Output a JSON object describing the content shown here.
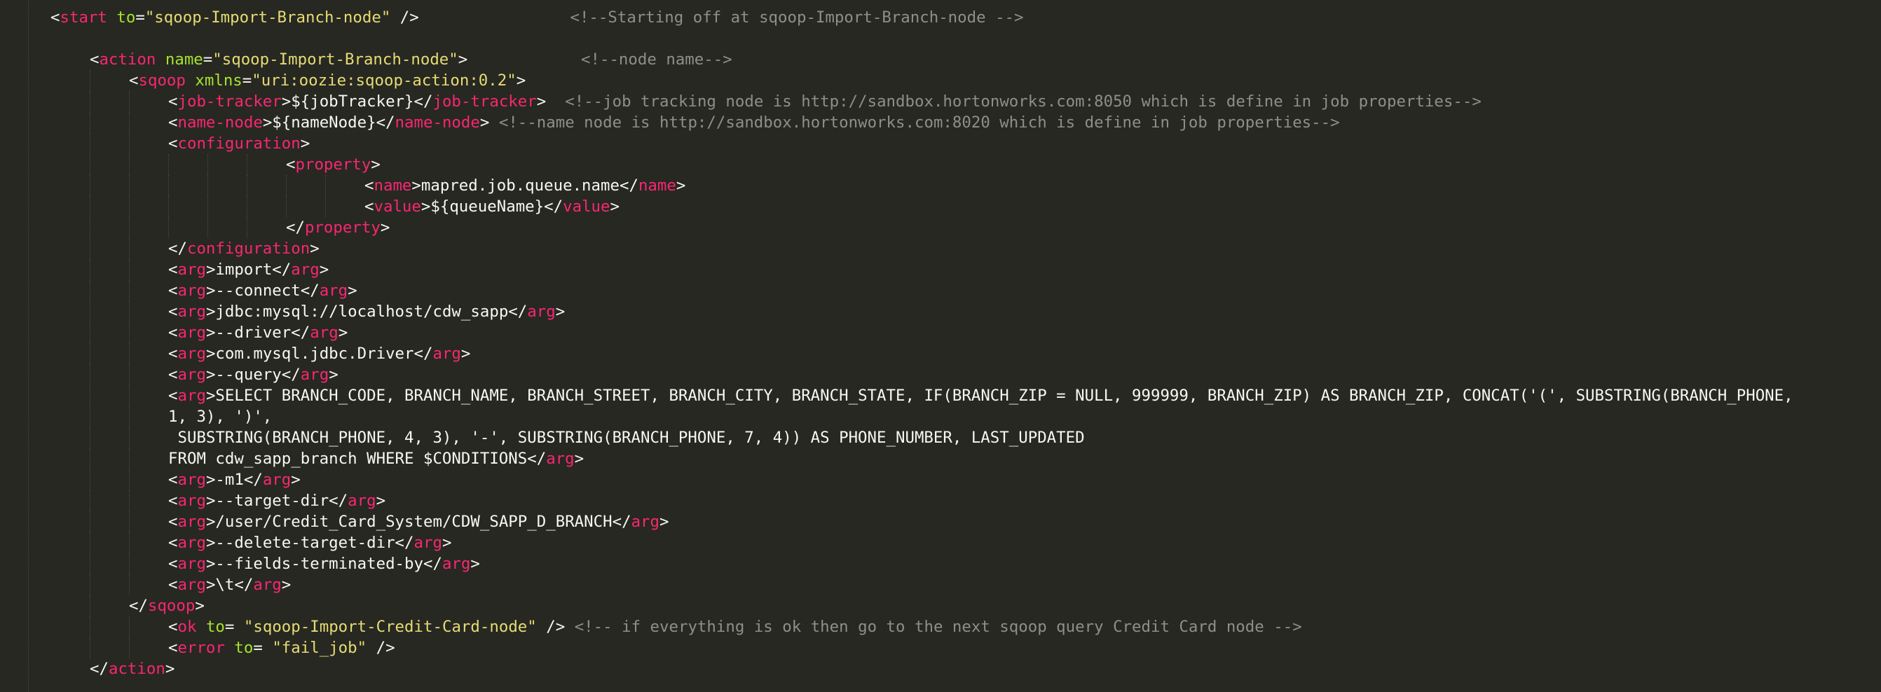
{
  "theme": {
    "background": "#272822",
    "plain": "#f8f8f2",
    "tag": "#f92672",
    "attribute": "#a6e22e",
    "string": "#e6db74",
    "comment": "#8f8f88"
  },
  "lines": [
    {
      "segs": [
        [
          "p",
          "<"
        ],
        [
          "t",
          "start"
        ],
        [
          "p",
          " "
        ],
        [
          "a",
          "to"
        ],
        [
          "p",
          "="
        ],
        [
          "s",
          "\"sqoop-Import-Branch-node\""
        ],
        [
          "p",
          " />"
        ],
        [
          "p",
          "                "
        ],
        [
          "c",
          "<!--Starting off at sqoop-Import-Branch-node -->"
        ]
      ]
    },
    {
      "segs": []
    },
    {
      "segs": [
        [
          "p",
          "<"
        ],
        [
          "t",
          "action"
        ],
        [
          "p",
          " "
        ],
        [
          "a",
          "name"
        ],
        [
          "p",
          "="
        ],
        [
          "s",
          "\"sqoop-Import-Branch-node\""
        ],
        [
          "p",
          ">"
        ],
        [
          "p",
          "            "
        ],
        [
          "c",
          "<!--node name-->"
        ]
      ]
    },
    {
      "segs": [
        [
          "p",
          "<"
        ],
        [
          "t",
          "sqoop"
        ],
        [
          "p",
          " "
        ],
        [
          "a",
          "xmlns"
        ],
        [
          "p",
          "="
        ],
        [
          "s",
          "\"uri:oozie:sqoop-action:0.2\""
        ],
        [
          "p",
          ">"
        ]
      ]
    },
    {
      "segs": [
        [
          "p",
          "<"
        ],
        [
          "t",
          "job-tracker"
        ],
        [
          "p",
          ">${jobTracker}</"
        ],
        [
          "t",
          "job-tracker"
        ],
        [
          "p",
          ">  "
        ],
        [
          "c",
          "<!--job tracking node is http://sandbox.hortonworks.com:8050 which is define in job properties-->"
        ]
      ]
    },
    {
      "segs": [
        [
          "p",
          "<"
        ],
        [
          "t",
          "name-node"
        ],
        [
          "p",
          ">${nameNode}</"
        ],
        [
          "t",
          "name-node"
        ],
        [
          "p",
          "> "
        ],
        [
          "c",
          "<!--name node is http://sandbox.hortonworks.com:8020 which is define in job properties-->"
        ]
      ]
    },
    {
      "segs": [
        [
          "p",
          "<"
        ],
        [
          "t",
          "configuration"
        ],
        [
          "p",
          ">"
        ]
      ]
    },
    {
      "segs": [
        [
          "p",
          "<"
        ],
        [
          "t",
          "property"
        ],
        [
          "p",
          ">"
        ]
      ]
    },
    {
      "segs": [
        [
          "p",
          "<"
        ],
        [
          "t",
          "name"
        ],
        [
          "p",
          ">mapred.job.queue.name</"
        ],
        [
          "t",
          "name"
        ],
        [
          "p",
          ">"
        ]
      ]
    },
    {
      "segs": [
        [
          "p",
          "<"
        ],
        [
          "t",
          "value"
        ],
        [
          "p",
          ">${queueName}</"
        ],
        [
          "t",
          "value"
        ],
        [
          "p",
          ">"
        ]
      ]
    },
    {
      "segs": [
        [
          "p",
          "</"
        ],
        [
          "t",
          "property"
        ],
        [
          "p",
          ">"
        ]
      ]
    },
    {
      "segs": [
        [
          "p",
          "</"
        ],
        [
          "t",
          "configuration"
        ],
        [
          "p",
          ">"
        ]
      ]
    },
    {
      "segs": [
        [
          "p",
          "<"
        ],
        [
          "t",
          "arg"
        ],
        [
          "p",
          ">import</"
        ],
        [
          "t",
          "arg"
        ],
        [
          "p",
          ">"
        ]
      ]
    },
    {
      "segs": [
        [
          "p",
          "<"
        ],
        [
          "t",
          "arg"
        ],
        [
          "p",
          ">--connect</"
        ],
        [
          "t",
          "arg"
        ],
        [
          "p",
          ">"
        ]
      ]
    },
    {
      "segs": [
        [
          "p",
          "<"
        ],
        [
          "t",
          "arg"
        ],
        [
          "p",
          ">jdbc:mysql://localhost/cdw_sapp</"
        ],
        [
          "t",
          "arg"
        ],
        [
          "p",
          ">"
        ]
      ]
    },
    {
      "segs": [
        [
          "p",
          "<"
        ],
        [
          "t",
          "arg"
        ],
        [
          "p",
          ">--driver</"
        ],
        [
          "t",
          "arg"
        ],
        [
          "p",
          ">"
        ]
      ]
    },
    {
      "segs": [
        [
          "p",
          "<"
        ],
        [
          "t",
          "arg"
        ],
        [
          "p",
          ">com.mysql.jdbc.Driver</"
        ],
        [
          "t",
          "arg"
        ],
        [
          "p",
          ">"
        ]
      ]
    },
    {
      "segs": [
        [
          "p",
          "<"
        ],
        [
          "t",
          "arg"
        ],
        [
          "p",
          ">--query</"
        ],
        [
          "t",
          "arg"
        ],
        [
          "p",
          ">"
        ]
      ]
    },
    {
      "segs": [
        [
          "p",
          "<"
        ],
        [
          "t",
          "arg"
        ],
        [
          "p",
          ">SELECT BRANCH_CODE, BRANCH_NAME, BRANCH_STREET, BRANCH_CITY, BRANCH_STATE, IF(BRANCH_ZIP = NULL, 999999, BRANCH_ZIP) AS BRANCH_ZIP, CONCAT('(', SUBSTRING(BRANCH_PHONE,"
        ]
      ]
    },
    {
      "segs": [
        [
          "p",
          "1, 3), ')',"
        ]
      ]
    },
    {
      "segs": [
        [
          "p",
          " SUBSTRING(BRANCH_PHONE, 4, 3), '-', SUBSTRING(BRANCH_PHONE, 7, 4)) AS PHONE_NUMBER, LAST_UPDATED"
        ]
      ]
    },
    {
      "segs": [
        [
          "p",
          "FROM cdw_sapp_branch WHERE $CONDITIONS</"
        ],
        [
          "t",
          "arg"
        ],
        [
          "p",
          ">"
        ]
      ]
    },
    {
      "segs": [
        [
          "p",
          "<"
        ],
        [
          "t",
          "arg"
        ],
        [
          "p",
          ">-m1</"
        ],
        [
          "t",
          "arg"
        ],
        [
          "p",
          ">"
        ]
      ]
    },
    {
      "segs": [
        [
          "p",
          "<"
        ],
        [
          "t",
          "arg"
        ],
        [
          "p",
          ">--target-dir</"
        ],
        [
          "t",
          "arg"
        ],
        [
          "p",
          ">"
        ]
      ]
    },
    {
      "segs": [
        [
          "p",
          "<"
        ],
        [
          "t",
          "arg"
        ],
        [
          "p",
          ">/user/Credit_Card_System/CDW_SAPP_D_BRANCH</"
        ],
        [
          "t",
          "arg"
        ],
        [
          "p",
          ">"
        ]
      ]
    },
    {
      "segs": [
        [
          "p",
          "<"
        ],
        [
          "t",
          "arg"
        ],
        [
          "p",
          ">--delete-target-dir</"
        ],
        [
          "t",
          "arg"
        ],
        [
          "p",
          ">"
        ]
      ]
    },
    {
      "segs": [
        [
          "p",
          "<"
        ],
        [
          "t",
          "arg"
        ],
        [
          "p",
          ">--fields-terminated-by</"
        ],
        [
          "t",
          "arg"
        ],
        [
          "p",
          ">"
        ]
      ]
    },
    {
      "segs": [
        [
          "p",
          "<"
        ],
        [
          "t",
          "arg"
        ],
        [
          "p",
          ">\\t</"
        ],
        [
          "t",
          "arg"
        ],
        [
          "p",
          ">"
        ]
      ]
    },
    {
      "segs": [
        [
          "p",
          "</"
        ],
        [
          "t",
          "sqoop"
        ],
        [
          "p",
          ">"
        ]
      ]
    },
    {
      "segs": [
        [
          "p",
          "<"
        ],
        [
          "t",
          "ok"
        ],
        [
          "p",
          " "
        ],
        [
          "a",
          "to"
        ],
        [
          "p",
          "= "
        ],
        [
          "s",
          "\"sqoop-Import-Credit-Card-node\""
        ],
        [
          "p",
          " /> "
        ],
        [
          "c",
          "<!-- if everything is ok then go to the next sqoop query Credit Card node -->"
        ]
      ]
    },
    {
      "segs": [
        [
          "p",
          "<"
        ],
        [
          "t",
          "error"
        ],
        [
          "p",
          " "
        ],
        [
          "a",
          "to"
        ],
        [
          "p",
          "= "
        ],
        [
          "s",
          "\"fail_job\""
        ],
        [
          "p",
          " />"
        ]
      ]
    },
    {
      "segs": [
        [
          "p",
          "</"
        ],
        [
          "t",
          "action"
        ],
        [
          "p",
          ">"
        ]
      ]
    }
  ]
}
